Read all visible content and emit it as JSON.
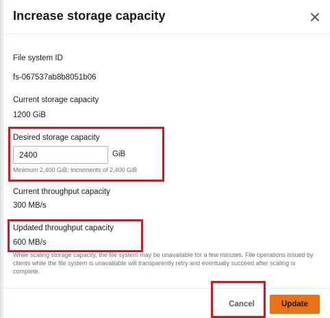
{
  "dialog": {
    "title": "Increase storage capacity",
    "close_icon": "close-x-icon"
  },
  "fields": {
    "file_system_id": {
      "label": "File system ID",
      "value": "fs-067537ab8b8051b06"
    },
    "current_storage": {
      "label": "Current storage capacity",
      "value": "1200 GiB"
    },
    "desired_storage": {
      "label": "Desired storage capacity",
      "value": "2400",
      "unit": "GiB",
      "hint": "Minimum 2,400 GiB; Increments of 2,400 GiB"
    },
    "current_throughput": {
      "label": "Current throughput capacity",
      "value": "300 MB/s"
    },
    "updated_throughput": {
      "label": "Updated throughput capacity",
      "value": "600 MB/s"
    }
  },
  "note": "While scaling storage capacity, the file system may be unavailable for a few minutes. File operations issued by clients while the file system is unavailable will transparently retry and eventually succeed after scaling is complete.",
  "footer": {
    "cancel_label": "Cancel",
    "update_label": "Update"
  },
  "colors": {
    "primary_button": "#ec7211",
    "highlight_border": "#e0101e",
    "hint_text": "#687078"
  }
}
